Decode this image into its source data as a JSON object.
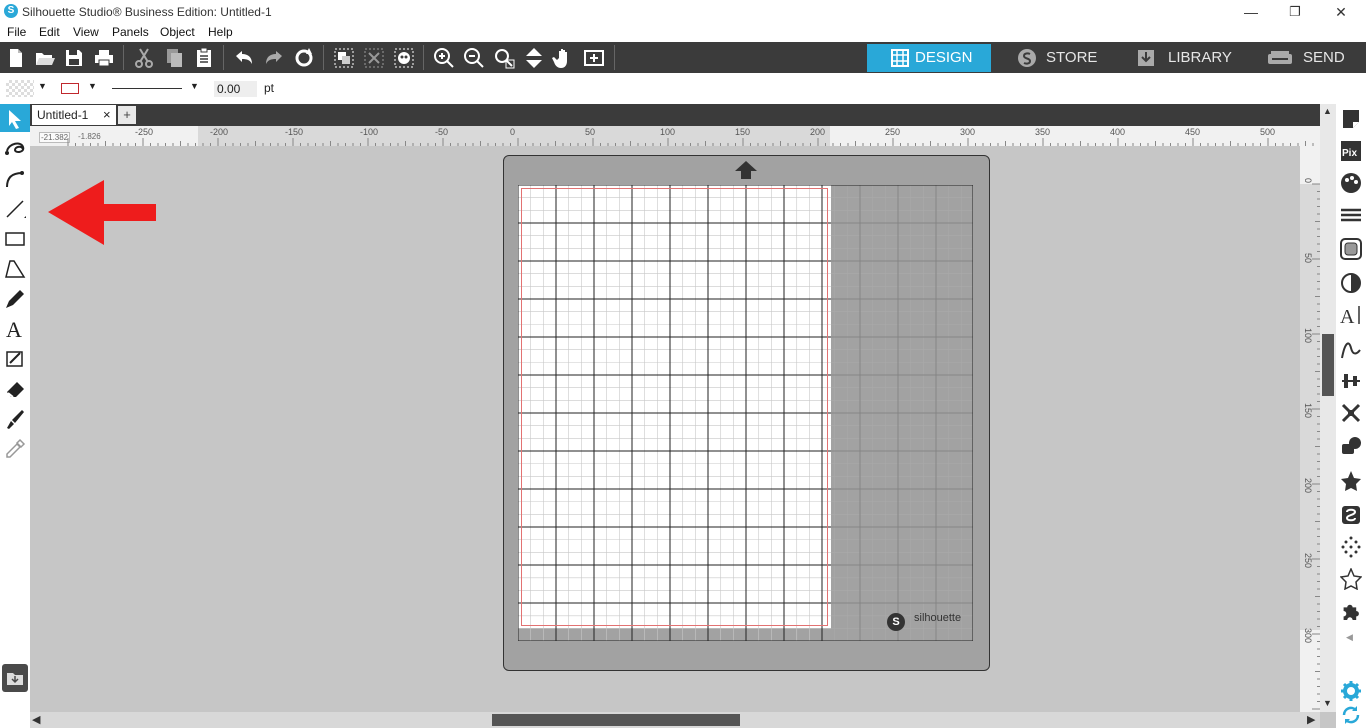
{
  "window": {
    "title": "Silhouette Studio® Business Edition: Untitled-1",
    "logo_letter": "S",
    "minimize": "—",
    "restore": "❐",
    "close": "✕"
  },
  "menu": {
    "items": [
      "File",
      "Edit",
      "View",
      "Panels",
      "Object",
      "Help"
    ]
  },
  "toolbar": {
    "icons": [
      "new-file-icon",
      "open-folder-icon",
      "save-icon",
      "print-icon",
      "cut-icon",
      "copy-icon",
      "paste-icon",
      "undo-icon",
      "redo-icon",
      "redraw-icon",
      "group-icon",
      "ungroup-icon",
      "compound-path-icon",
      "zoom-in-icon",
      "zoom-out-icon",
      "zoom-select-icon",
      "fit-to-page-icon",
      "pan-hand-icon",
      "fit-to-window-icon"
    ],
    "nav_tabs": [
      {
        "label": "DESIGN",
        "icon": "grid-icon",
        "active": true
      },
      {
        "label": "STORE",
        "icon": "silhouette-s-icon",
        "active": false
      },
      {
        "label": "LIBRARY",
        "icon": "library-download-icon",
        "active": false
      },
      {
        "label": "SEND",
        "icon": "cutter-icon",
        "active": false
      }
    ],
    "active_color": "#29a8d8"
  },
  "options": {
    "line_width_value": "0.00",
    "line_width_unit": "pt",
    "line_color": "#c0282d"
  },
  "doc": {
    "tab_label": "Untitled-1",
    "tab_close": "×",
    "add_tab": "+",
    "coords_x": "-21.382",
    "coords_y": "-1.826"
  },
  "ruler": {
    "h_labels": [
      "-250",
      "-200",
      "-150",
      "-100",
      "-50",
      "0",
      "50",
      "100",
      "150",
      "200",
      "250",
      "300",
      "350",
      "400",
      "450",
      "500"
    ],
    "v_labels": [
      "0",
      "50",
      "100",
      "150",
      "200",
      "250",
      "300"
    ]
  },
  "canvas": {
    "mat_brand": "silhouette",
    "mat_logo_letter": "S",
    "annotation_color": "#ee1c1c"
  },
  "left_tools": [
    "select-arrow-icon",
    "point-edit-icon",
    "curve-icon",
    "line-tool-icon",
    "rectangle-tool-icon",
    "polygon-tool-icon",
    "pencil-tool-icon",
    "text-tool-icon",
    "knife-tool-icon",
    "eraser-tool-icon",
    "paintbrush-tool-icon",
    "eyedropper-tool-icon"
  ],
  "right_panels": [
    "page-setup-icon",
    "pixscan-icon",
    "fill-color-icon",
    "line-style-icon",
    "trace-icon",
    "shadow-icon",
    "text-style-icon",
    "sketch-icon",
    "align-icon",
    "replicate-icon",
    "modify-icon",
    "library-favorite-icon",
    "offset-icon",
    "rhinestone-icon",
    "star-outline-icon",
    "puzzle-icon",
    "settings-gear-icon",
    "sync-icon"
  ]
}
